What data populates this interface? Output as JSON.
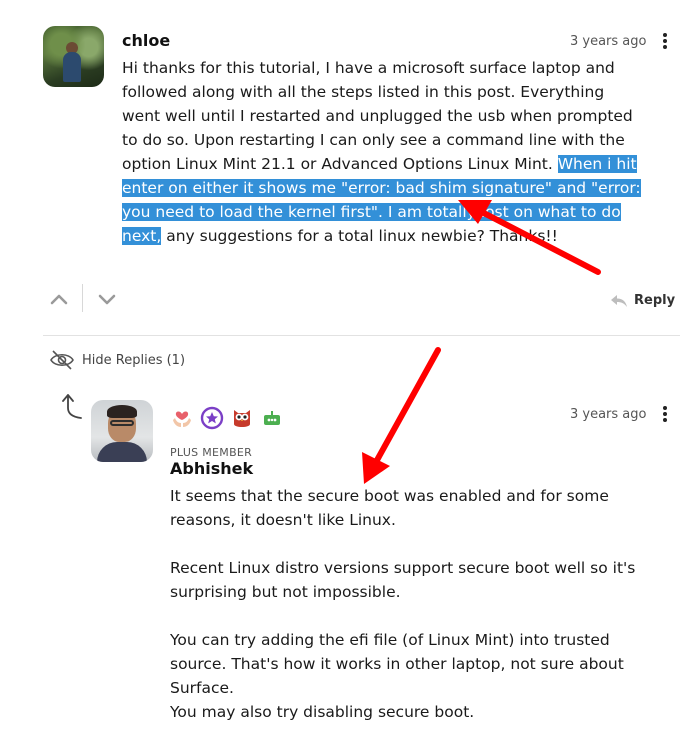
{
  "comment": {
    "author": "chloe",
    "time": "3 years ago",
    "text_before": "Hi thanks for this tutorial, I have a microsoft surface laptop and followed along with all the steps listed in this post. Everything went well until I restarted and unplugged the usb when prompted to do so. Upon restarting I can only see a command line with the option Linux Mint 21.1 or Advanced Options Linux Mint. ",
    "text_highlight": "When i hit enter on either it shows me \"error: bad shim signature\" and \"error: you need to load the kernel first\". I am totally lost on what to do next,",
    "text_after": " any suggestions for a total linux newbie? Thanks!!",
    "reply_label": "Reply"
  },
  "replies_toggle": {
    "label": "Hide Replies",
    "count": "(1)"
  },
  "reply": {
    "role": "PLUS MEMBER",
    "author": "Abhishek",
    "time": "3 years ago",
    "badges": [
      "heart-hands-badge",
      "star-chat-badge",
      "owl-badge",
      "robot-badge"
    ],
    "paragraphs": [
      "It seems that the secure boot was enabled and for some reasons, it doesn't like Linux.",
      "Recent Linux distro versions support secure boot well so it's surprising but not impossible.",
      "You can try adding the efi file (of Linux Mint) into trusted source. That's how it works in other laptop, not sure about Surface.",
      "You may also try disabling secure boot."
    ]
  },
  "colors": {
    "highlight": "#3390d8",
    "annotation_arrow": "#ff0000"
  }
}
